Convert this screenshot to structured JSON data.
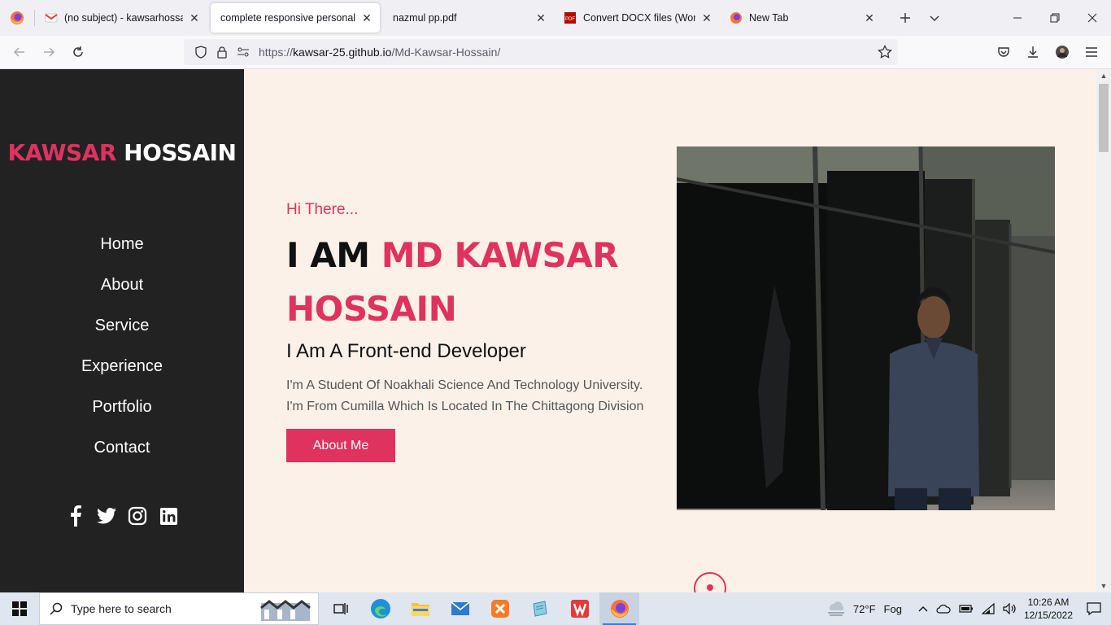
{
  "browser": {
    "tabs": [
      {
        "title": "(no subject) - kawsarhossain4",
        "icon": "gmail-icon",
        "active": false
      },
      {
        "title": "complete responsive personal po",
        "icon": "",
        "active": true
      },
      {
        "title": "nazmul pp.pdf",
        "icon": "",
        "active": false
      },
      {
        "title": "Convert DOCX files (Word) to",
        "icon": "pdf-icon",
        "active": false
      },
      {
        "title": "New Tab",
        "icon": "firefox-icon",
        "active": false
      }
    ],
    "url_prefix": "https://",
    "url_host": "kawsar-25.github.io",
    "url_path": "/Md-Kawsar-Hossain/"
  },
  "site": {
    "brand_first": "KAWSAR",
    "brand_last": "HOSSAIN",
    "menu": [
      "Home",
      "About",
      "Service",
      "Experience",
      "Portfolio",
      "Contact"
    ],
    "socials": [
      "facebook-icon",
      "twitter-icon",
      "instagram-icon",
      "linkedin-icon"
    ],
    "greeting": "Hi There...",
    "iam_prefix": "I AM",
    "iam_name": "MD KAWSAR HOSSAIN",
    "role": "I Am A Front-end Developer",
    "description_line1": "I'm A Student Of Noakhali Science And Technology University.",
    "description_line2": "I'm From Cumilla Which Is Located In The Chittagong Division",
    "cta_label": "About Me",
    "accent_color": "#e0325f",
    "sidebar_color": "#222222",
    "background_color": "#fcf1e8"
  },
  "taskbar": {
    "search_placeholder": "Type here to search",
    "weather_temp": "72°F",
    "weather_desc": "Fog",
    "time": "10:26 AM",
    "date": "12/15/2022"
  }
}
